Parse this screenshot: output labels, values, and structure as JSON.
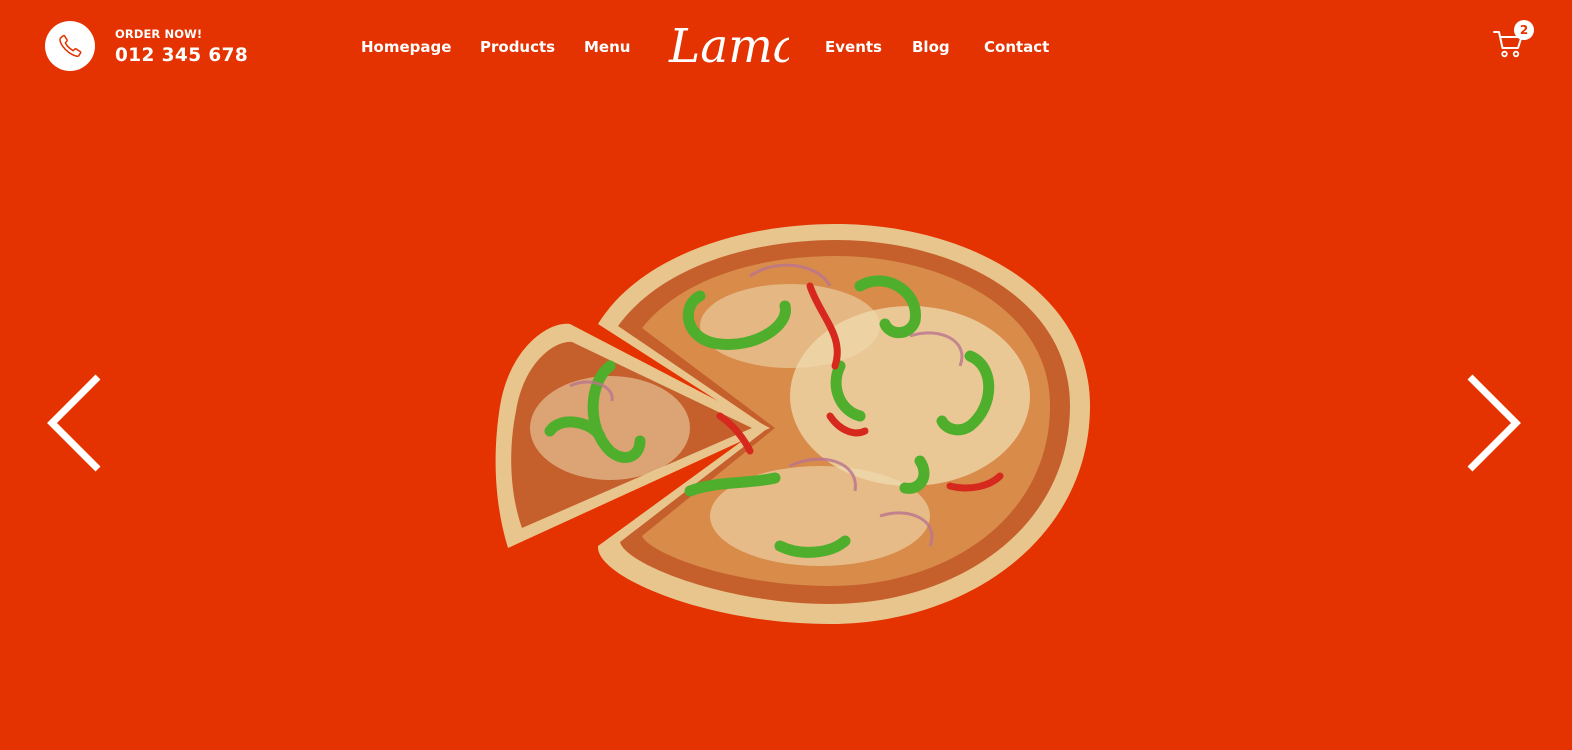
{
  "header": {
    "order_label": "ORDER NOW!",
    "order_number": "012 345 678",
    "phone_icon": "phone-icon",
    "logo_text": "Lama",
    "nav": [
      {
        "label": "Homepage"
      },
      {
        "label": "Products"
      },
      {
        "label": "Menu"
      },
      {
        "label": "Events"
      },
      {
        "label": "Blog"
      },
      {
        "label": "Contact"
      }
    ],
    "cart": {
      "icon": "cart-icon",
      "count": "2"
    }
  },
  "hero": {
    "prev_icon": "chevron-left-icon",
    "next_icon": "chevron-right-icon",
    "image": "pizza-image"
  },
  "colors": {
    "background": "#e43200",
    "foreground": "#ffffff"
  }
}
